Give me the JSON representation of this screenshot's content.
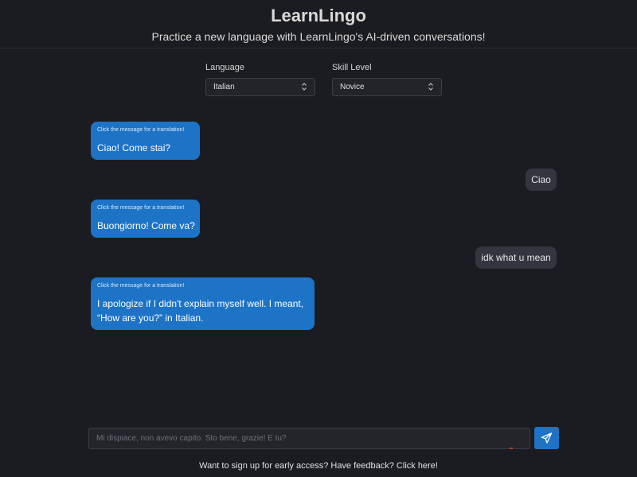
{
  "header": {
    "title": "LearnLingo",
    "subtitle": "Practice a new language with LearnLingo's AI-driven conversations!"
  },
  "settings": {
    "language_label": "Language",
    "language_value": "Italian",
    "skill_label": "Skill Level",
    "skill_value": "Novice"
  },
  "chat": {
    "translation_hint": "Click the message for a translation!",
    "messages": [
      {
        "role": "bot",
        "text": "Ciao! Come stai?"
      },
      {
        "role": "user",
        "text": "Ciao"
      },
      {
        "role": "bot",
        "text": "Buongiorno! Come va?"
      },
      {
        "role": "user",
        "text": "idk what u mean"
      },
      {
        "role": "bot",
        "line1": "I apologize if I didn't explain myself well. I meant,",
        "line2": "“How are you?” in Italian."
      }
    ]
  },
  "composer": {
    "placeholder": "Mi dispiace, non avevo capito. Sto bene, grazie! E tu?",
    "send_icon": "paper-plane-icon"
  },
  "footer": {
    "link_text": "Want to sign up for early access? Have feedback? Click here!"
  },
  "colors": {
    "background": "#1b1c21",
    "accent": "#1d73c6",
    "user_bubble": "#33363e"
  }
}
